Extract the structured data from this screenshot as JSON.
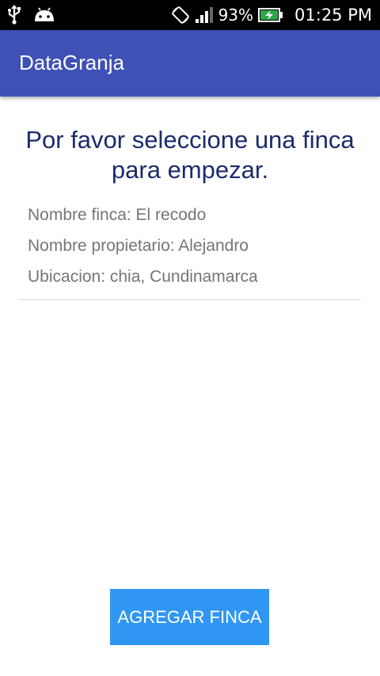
{
  "status_bar": {
    "battery": "93%",
    "time": "01:25 PM",
    "icons": [
      "usb-icon",
      "android-icon",
      "screen-rotation-icon",
      "signal-icon",
      "battery-charging-icon"
    ]
  },
  "app_bar": {
    "title": "DataGranja"
  },
  "main": {
    "prompt": "Por favor seleccione una finca para empezar.",
    "farms": [
      {
        "name": "Nombre finca: El recodo",
        "owner": "Nombre propietario: Alejandro",
        "location": "Ubicacion: chia, Cundinamarca"
      }
    ],
    "add_button_label": "AGREGAR FINCA"
  },
  "colors": {
    "app_bar": "#3f51b5",
    "prompt_text": "#1a2b6d",
    "secondary_text": "#757575",
    "button": "#2f96f3"
  }
}
